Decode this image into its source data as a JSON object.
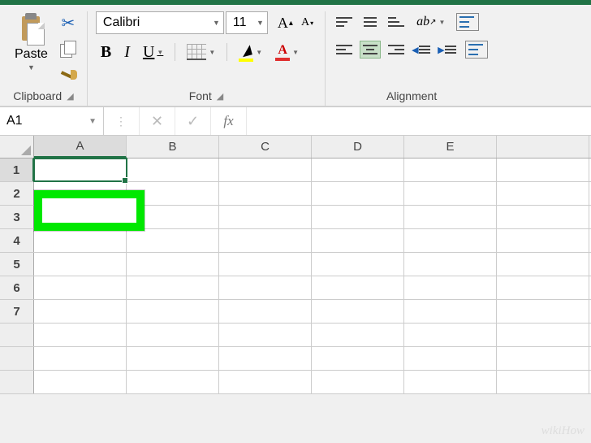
{
  "ribbon": {
    "clipboard": {
      "label": "Clipboard",
      "paste": "Paste"
    },
    "font": {
      "label": "Font",
      "name": "Calibri",
      "size": "11",
      "bold": "B",
      "italic": "I",
      "underline": "U",
      "grow": "A",
      "shrink": "A",
      "fontcolor_a": "A"
    },
    "alignment": {
      "label": "Alignment",
      "orient": "ab"
    }
  },
  "formula_bar": {
    "name_box": "A1",
    "fx": "fx",
    "value": ""
  },
  "columns": [
    "A",
    "B",
    "C",
    "D",
    "E"
  ],
  "rows": [
    "1",
    "2",
    "3",
    "4",
    "5",
    "6",
    "7"
  ],
  "watermark": "wikiHow"
}
